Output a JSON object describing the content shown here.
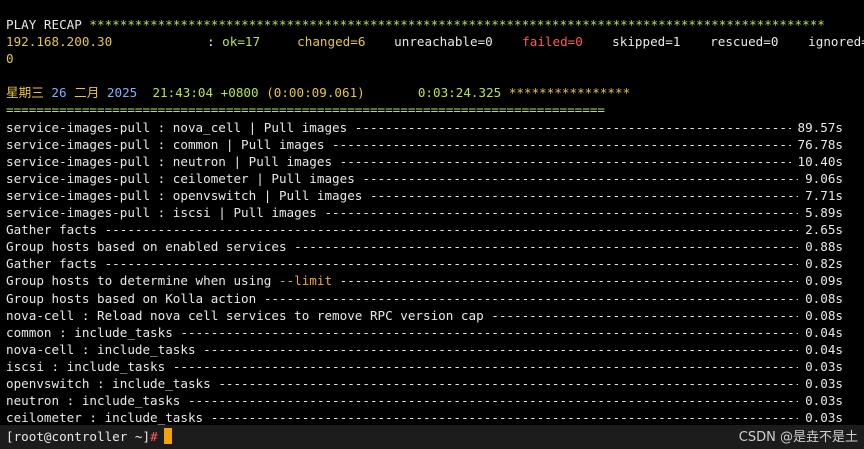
{
  "recap": {
    "header": "PLAY RECAP",
    "stars": "*************************************************************************************************",
    "host": "192.168.200.30",
    "sep": ": ",
    "ok": "ok=17",
    "changed": "changed=6",
    "unreachable": "unreachable=0",
    "failed": "failed=0",
    "skipped": "skipped=1",
    "rescued": "rescued=0",
    "ignored": "ignored=",
    "ignored_wrap": "0"
  },
  "timing": {
    "weekday": "星期三",
    "day": "26",
    "month": "二月",
    "year": "2025",
    "time": "21:43:04 +0800",
    "delta": "(0:00:09.061)",
    "total": "0:03:24.325",
    "stars": "****************",
    "separator": "==============================================================================="
  },
  "tasks": [
    {
      "name": "service-images-pull : nova_cell | Pull images",
      "duration": "89.57s"
    },
    {
      "name": "service-images-pull : common | Pull images",
      "duration": "76.78s"
    },
    {
      "name": "service-images-pull : neutron | Pull images",
      "duration": "10.40s"
    },
    {
      "name": "service-images-pull : ceilometer | Pull images",
      "duration": "9.06s"
    },
    {
      "name": "service-images-pull : openvswitch | Pull images",
      "duration": "7.71s"
    },
    {
      "name": "service-images-pull : iscsi | Pull images",
      "duration": "5.89s"
    },
    {
      "name": "Gather facts",
      "duration": "2.65s"
    },
    {
      "name": "Group hosts based on enabled services",
      "duration": "0.88s"
    },
    {
      "name": "Gather facts",
      "duration": "0.82s"
    },
    {
      "name": "Group hosts to determine when using ",
      "highlight": "--limit",
      "duration": "0.09s"
    },
    {
      "name": "Group hosts based on Kolla action",
      "duration": "0.08s"
    },
    {
      "name": "nova-cell : Reload nova cell services to remove RPC version cap",
      "duration": "0.08s"
    },
    {
      "name": "common : include_tasks",
      "duration": "0.04s"
    },
    {
      "name": "nova-cell : include_tasks",
      "duration": "0.04s"
    },
    {
      "name": "iscsi : include_tasks",
      "duration": "0.03s"
    },
    {
      "name": "openvswitch : include_tasks",
      "duration": "0.03s"
    },
    {
      "name": "neutron : include_tasks",
      "duration": "0.03s"
    },
    {
      "name": "ceilometer : include_tasks",
      "duration": "0.03s"
    }
  ],
  "prompt": {
    "text": "[root@controller ~]",
    "hash": "#"
  },
  "watermark": "CSDN @是垚不是土",
  "colors": {
    "green": "#b7e44a",
    "yellow": "#e5c644",
    "red": "#ff5a5a",
    "orange": "#e8a33d",
    "cursor": "#f0a30a"
  }
}
